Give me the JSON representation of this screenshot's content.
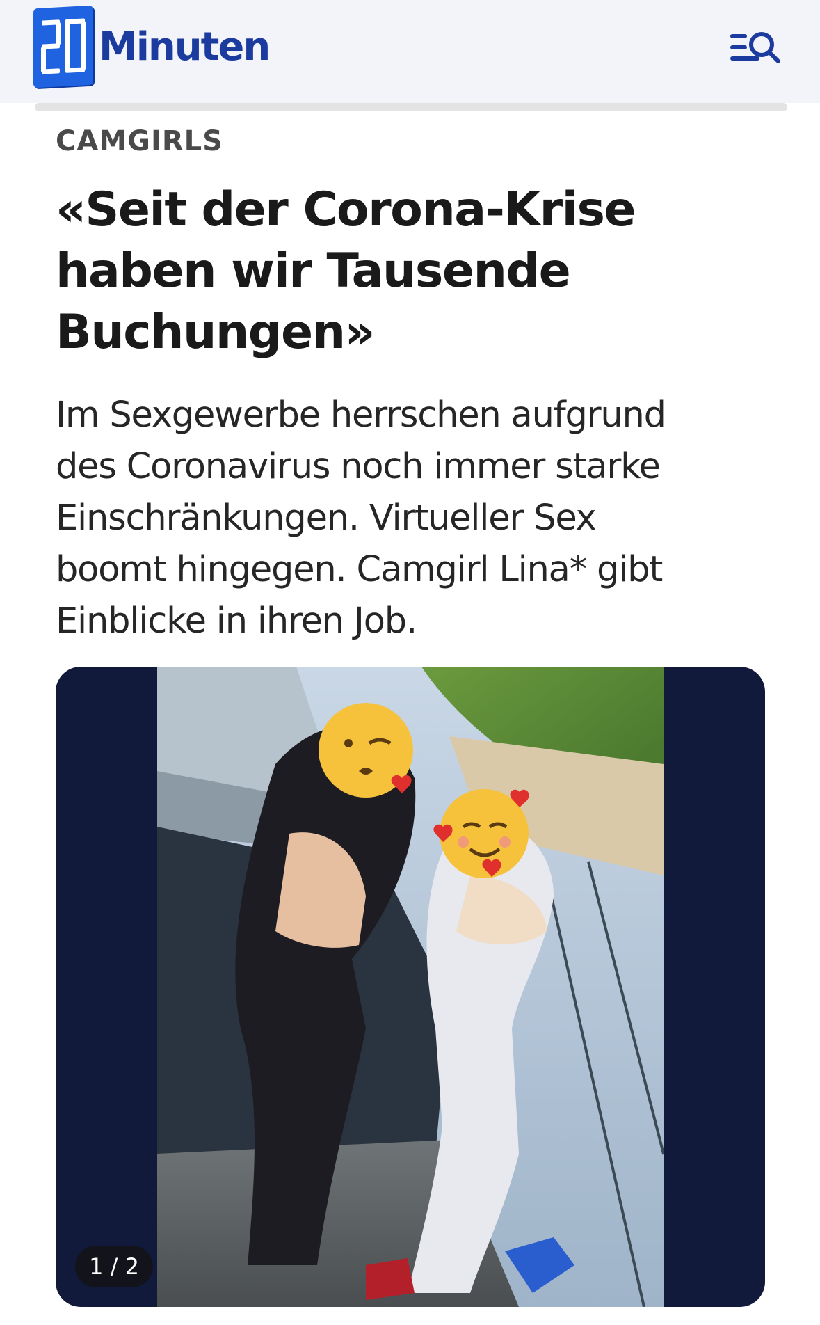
{
  "header": {
    "logo_text": "Minuten",
    "logo_number": "20",
    "menu_search_icon": "menu-search-icon",
    "brand_color": "#1f63e0"
  },
  "article": {
    "kicker": "CAMGIRLS",
    "headline_lines": [
      "«Seit der Corona-Krise",
      "haben wir Tausende",
      "Buchungen»"
    ],
    "lead_lines": [
      "Im Sexgewerbe herrschen aufgrund",
      "des Coronavirus noch immer starke",
      "Einschränkungen. Virtueller Sex",
      "boomt hingegen. Camgirl Lina* gibt",
      "Einblicke in ihren Job."
    ]
  },
  "gallery": {
    "counter": "1 / 2",
    "background_color": "#121a3c"
  }
}
